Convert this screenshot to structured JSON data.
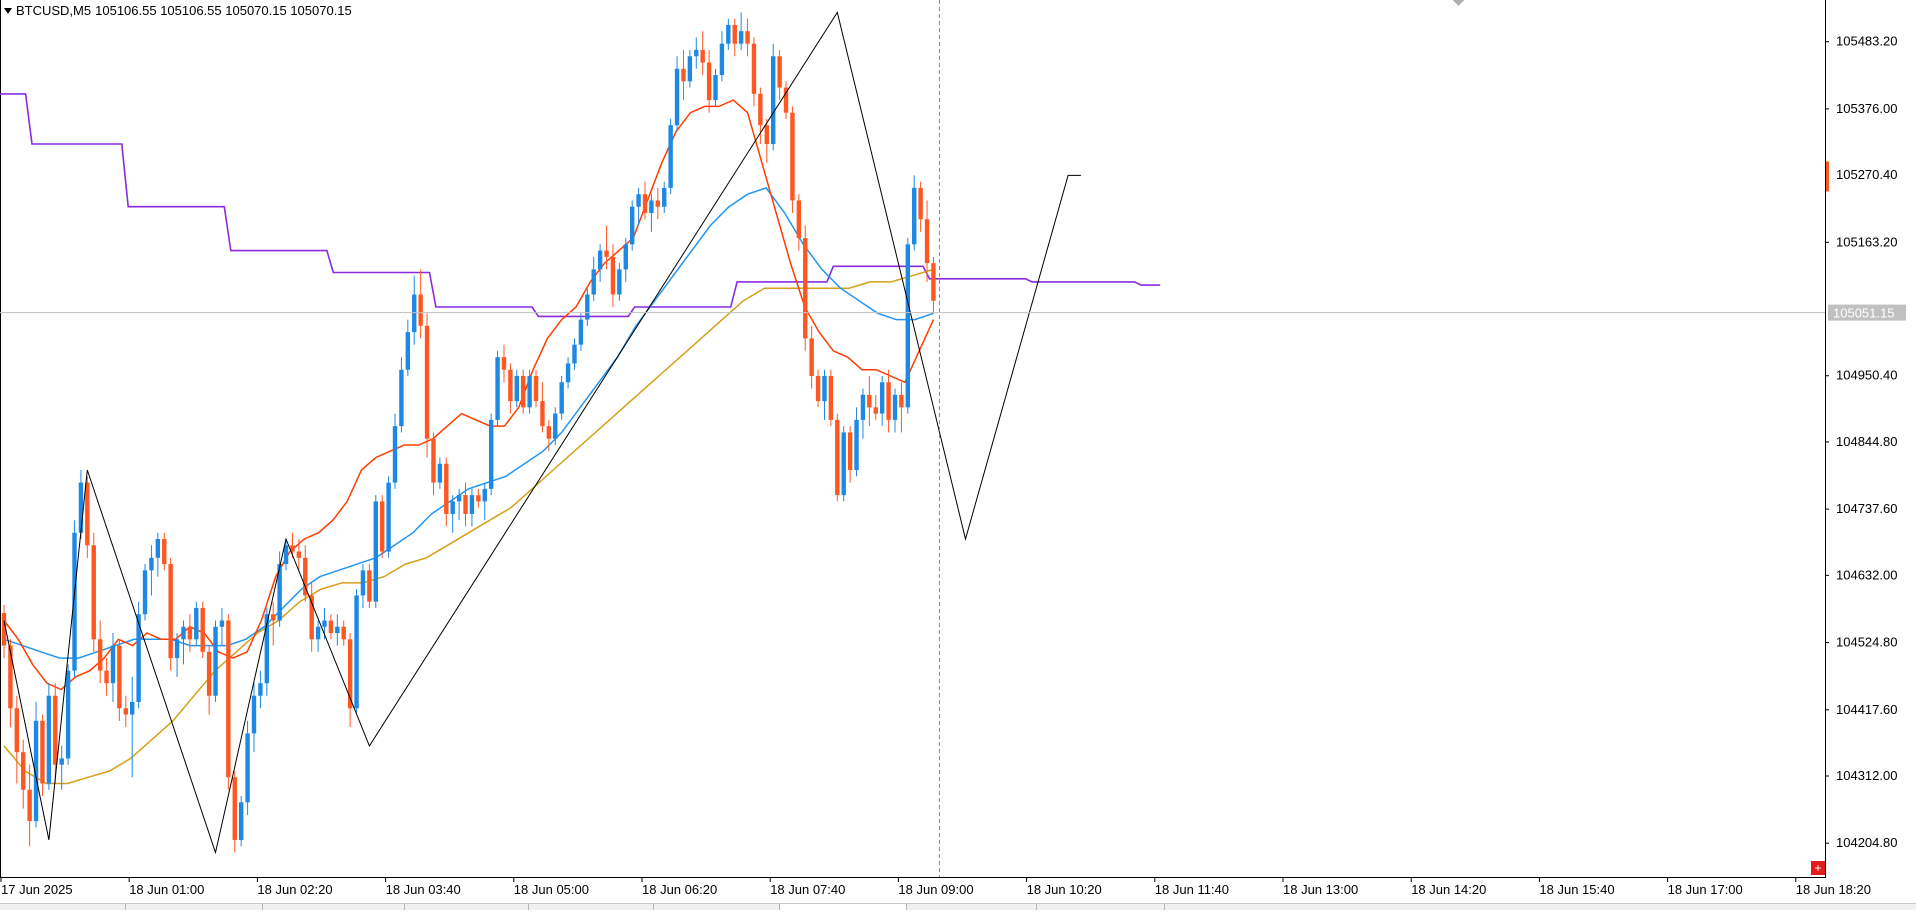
{
  "header": {
    "symbol_label": "BTCUSD,M5",
    "ohlc": "105106.55 105106.55 105070.15 105070.15",
    "dropdown_icon": "triangle-down-icon"
  },
  "price_axis": {
    "labels": [
      "105483.20",
      "105376.00",
      "105270.40",
      "105163.20",
      "104950.40",
      "104844.80",
      "104737.60",
      "104632.00",
      "104524.80",
      "104417.60",
      "104312.00",
      "104204.80"
    ],
    "current_price_tag": "105051.15",
    "ylim": [
      104170,
      105560
    ]
  },
  "time_axis": {
    "labels": [
      "17 Jun 2025",
      "18 Jun 01:00",
      "18 Jun 02:20",
      "18 Jun 03:40",
      "18 Jun 05:00",
      "18 Jun 06:20",
      "18 Jun 07:40",
      "18 Jun 09:00",
      "18 Jun 10:20",
      "18 Jun 11:40",
      "18 Jun 13:00",
      "18 Jun 14:20",
      "18 Jun 15:40",
      "18 Jun 17:00",
      "18 Jun 18:20"
    ]
  },
  "colors": {
    "bull": "#1e88e5",
    "bear": "#ff5722",
    "ma_fast": "#ff3d00",
    "ma_mid": "#2196f3",
    "ma_slow": "#d4a017",
    "step_line": "#8a2be2",
    "zigzag": "#000000",
    "price_tag_bg": "#c0c0c0",
    "last_candle_marker": "#ff5722"
  },
  "chart_data": {
    "type": "candlestick",
    "symbol": "BTCUSD",
    "timeframe": "M5",
    "candle_step_minutes": 5,
    "candles": [
      [
        104572,
        104585,
        104500,
        104520
      ],
      [
        104520,
        104530,
        104390,
        104420
      ],
      [
        104420,
        104440,
        104300,
        104350
      ],
      [
        104350,
        104370,
        104260,
        104290
      ],
      [
        104290,
        104330,
        104200,
        104240
      ],
      [
        104240,
        104430,
        104230,
        104400
      ],
      [
        104400,
        104410,
        104280,
        104300
      ],
      [
        104300,
        104460,
        104290,
        104440
      ],
      [
        104440,
        104460,
        104300,
        104330
      ],
      [
        104330,
        104360,
        104290,
        104340
      ],
      [
        104340,
        104490,
        104330,
        104480
      ],
      [
        104480,
        104720,
        104470,
        104700
      ],
      [
        104700,
        104800,
        104690,
        104780
      ],
      [
        104780,
        104790,
        104660,
        104680
      ],
      [
        104680,
        104700,
        104510,
        104530
      ],
      [
        104530,
        104560,
        104460,
        104480
      ],
      [
        104480,
        104500,
        104440,
        104460
      ],
      [
        104460,
        104540,
        104430,
        104520
      ],
      [
        104520,
        104530,
        104400,
        104420
      ],
      [
        104420,
        104440,
        104390,
        104410
      ],
      [
        104410,
        104470,
        104310,
        104430
      ],
      [
        104430,
        104590,
        104420,
        104570
      ],
      [
        104570,
        104650,
        104560,
        104640
      ],
      [
        104640,
        104680,
        104600,
        104660
      ],
      [
        104660,
        104700,
        104630,
        104690
      ],
      [
        104690,
        104700,
        104640,
        104650
      ],
      [
        104650,
        104660,
        104480,
        104500
      ],
      [
        104500,
        104540,
        104470,
        104530
      ],
      [
        104530,
        104560,
        104490,
        104550
      ],
      [
        104550,
        104570,
        104510,
        104530
      ],
      [
        104530,
        104590,
        104520,
        104580
      ],
      [
        104580,
        104590,
        104500,
        104510
      ],
      [
        104510,
        104520,
        104410,
        104440
      ],
      [
        104440,
        104560,
        104430,
        104550
      ],
      [
        104550,
        104580,
        104520,
        104560
      ],
      [
        104560,
        104570,
        104290,
        104310
      ],
      [
        104310,
        104320,
        104190,
        104210
      ],
      [
        104210,
        104280,
        104200,
        104270
      ],
      [
        104270,
        104400,
        104250,
        104380
      ],
      [
        104380,
        104460,
        104350,
        104440
      ],
      [
        104440,
        104480,
        104420,
        104460
      ],
      [
        104460,
        104580,
        104440,
        104570
      ],
      [
        104570,
        104590,
        104520,
        104560
      ],
      [
        104560,
        104670,
        104550,
        104650
      ],
      [
        104650,
        104690,
        104640,
        104680
      ],
      [
        104680,
        104700,
        104660,
        104670
      ],
      [
        104670,
        104690,
        104640,
        104660
      ],
      [
        104660,
        104680,
        104590,
        104600
      ],
      [
        104600,
        104620,
        104510,
        104530
      ],
      [
        104530,
        104560,
        104510,
        104550
      ],
      [
        104550,
        104580,
        104530,
        104560
      ],
      [
        104560,
        104570,
        104530,
        104540
      ],
      [
        104540,
        104570,
        104520,
        104550
      ],
      [
        104550,
        104560,
        104520,
        104530
      ],
      [
        104530,
        104540,
        104390,
        104420
      ],
      [
        104420,
        104610,
        104410,
        104600
      ],
      [
        104600,
        104650,
        104580,
        104640
      ],
      [
        104640,
        104650,
        104580,
        104590
      ],
      [
        104590,
        104760,
        104580,
        104750
      ],
      [
        104750,
        104760,
        104660,
        104670
      ],
      [
        104670,
        104790,
        104660,
        104780
      ],
      [
        104780,
        104890,
        104770,
        104870
      ],
      [
        104870,
        104980,
        104860,
        104960
      ],
      [
        104960,
        105040,
        104950,
        105020
      ],
      [
        105020,
        105110,
        105000,
        105080
      ],
      [
        105080,
        105120,
        105010,
        105030
      ],
      [
        105030,
        105050,
        104820,
        104850
      ],
      [
        104850,
        104860,
        104760,
        104780
      ],
      [
        104780,
        104820,
        104770,
        104810
      ],
      [
        104810,
        104820,
        104710,
        104730
      ],
      [
        104730,
        104760,
        104700,
        104750
      ],
      [
        104750,
        104770,
        104720,
        104760
      ],
      [
        104760,
        104780,
        104710,
        104730
      ],
      [
        104730,
        104770,
        104710,
        104760
      ],
      [
        104760,
        104770,
        104740,
        104750
      ],
      [
        104750,
        104780,
        104720,
        104770
      ],
      [
        104770,
        104890,
        104760,
        104880
      ],
      [
        104880,
        104990,
        104870,
        104980
      ],
      [
        104980,
        105000,
        104940,
        104960
      ],
      [
        104960,
        104970,
        104890,
        104910
      ],
      [
        104910,
        104960,
        104900,
        104950
      ],
      [
        104950,
        104960,
        104890,
        104900
      ],
      [
        104900,
        104960,
        104890,
        104950
      ],
      [
        104950,
        104960,
        104900,
        104910
      ],
      [
        104910,
        104940,
        104860,
        104870
      ],
      [
        104870,
        104880,
        104830,
        104850
      ],
      [
        104850,
        104900,
        104840,
        104890
      ],
      [
        104890,
        104950,
        104880,
        104940
      ],
      [
        104940,
        104980,
        104930,
        104970
      ],
      [
        104970,
        105010,
        104960,
        105000
      ],
      [
        105000,
        105050,
        104990,
        105040
      ],
      [
        105040,
        105090,
        105030,
        105080
      ],
      [
        105080,
        105140,
        105070,
        105120
      ],
      [
        105120,
        105160,
        105100,
        105150
      ],
      [
        105150,
        105190,
        105120,
        105140
      ],
      [
        105140,
        105160,
        105060,
        105080
      ],
      [
        105080,
        105130,
        105070,
        105120
      ],
      [
        105120,
        105170,
        105100,
        105160
      ],
      [
        105160,
        105230,
        105150,
        105220
      ],
      [
        105220,
        105250,
        105190,
        105240
      ],
      [
        105240,
        105260,
        105200,
        105210
      ],
      [
        105210,
        105240,
        105180,
        105230
      ],
      [
        105230,
        105250,
        105200,
        105220
      ],
      [
        105220,
        105260,
        105210,
        105250
      ],
      [
        105250,
        105360,
        105240,
        105350
      ],
      [
        105350,
        105460,
        105340,
        105440
      ],
      [
        105440,
        105470,
        105390,
        105420
      ],
      [
        105420,
        105470,
        105410,
        105460
      ],
      [
        105460,
        105490,
        105440,
        105470
      ],
      [
        105470,
        105500,
        105430,
        105450
      ],
      [
        105450,
        105470,
        105370,
        105390
      ],
      [
        105390,
        105440,
        105380,
        105430
      ],
      [
        105430,
        105500,
        105420,
        105480
      ],
      [
        105480,
        105520,
        105470,
        105510
      ],
      [
        105510,
        105520,
        105460,
        105480
      ],
      [
        105480,
        105530,
        105470,
        105500
      ],
      [
        105500,
        105520,
        105460,
        105480
      ],
      [
        105480,
        105490,
        105380,
        105400
      ],
      [
        105400,
        105410,
        105320,
        105350
      ],
      [
        105350,
        105360,
        105290,
        105320
      ],
      [
        105320,
        105480,
        105310,
        105460
      ],
      [
        105460,
        105470,
        105390,
        105410
      ],
      [
        105410,
        105420,
        105360,
        105370
      ],
      [
        105370,
        105380,
        105210,
        105230
      ],
      [
        105230,
        105240,
        105150,
        105170
      ],
      [
        105170,
        105190,
        104990,
        105010
      ],
      [
        105010,
        105030,
        104930,
        104950
      ],
      [
        104950,
        104960,
        104900,
        104910
      ],
      [
        104910,
        104960,
        104880,
        104950
      ],
      [
        104950,
        104960,
        104870,
        104880
      ],
      [
        104880,
        104890,
        104750,
        104760
      ],
      [
        104760,
        104870,
        104750,
        104860
      ],
      [
        104860,
        104870,
        104780,
        104800
      ],
      [
        104800,
        104900,
        104790,
        104880
      ],
      [
        104880,
        104930,
        104850,
        104920
      ],
      [
        104920,
        104950,
        104870,
        104900
      ],
      [
        104900,
        104920,
        104880,
        104890
      ],
      [
        104890,
        104950,
        104870,
        104940
      ],
      [
        104940,
        104960,
        104860,
        104880
      ],
      [
        104880,
        104930,
        104860,
        104920
      ],
      [
        104920,
        104940,
        104860,
        104900
      ],
      [
        104900,
        105170,
        104890,
        105160
      ],
      [
        105160,
        105270,
        105150,
        105250
      ],
      [
        105250,
        105260,
        105180,
        105200
      ],
      [
        105200,
        105230,
        105100,
        105130
      ],
      [
        105130,
        105140,
        105050,
        105070
      ]
    ],
    "ma_fast": [
      104560,
      104530,
      104490,
      104460,
      104450,
      104470,
      104480,
      104500,
      104530,
      104520,
      104540,
      104530,
      104530,
      104550,
      104540,
      104510,
      104500,
      104510,
      104560,
      104630,
      104670,
      104690,
      104700,
      104720,
      104750,
      104800,
      104820,
      104830,
      104840,
      104840,
      104850,
      104870,
      104890,
      104880,
      104870,
      104870,
      104900,
      104960,
      105010,
      105040,
      105060,
      105100,
      105130,
      105150,
      105170,
      105230,
      105290,
      105340,
      105370,
      105380,
      105380,
      105390,
      105370,
      105290,
      105210,
      105130,
      105060,
      105020,
      104990,
      104980,
      104960,
      104960,
      104950,
      104940,
      104990,
      105040
    ],
    "ma_mid": [
      104530,
      104520,
      104510,
      104500,
      104500,
      104510,
      104520,
      104530,
      104530,
      104530,
      104520,
      104520,
      104520,
      104530,
      104550,
      104580,
      104610,
      104630,
      104640,
      104650,
      104660,
      104680,
      104700,
      104730,
      104750,
      104770,
      104780,
      104790,
      104810,
      104830,
      104860,
      104900,
      104940,
      104980,
      105030,
      105070,
      105110,
      105150,
      105190,
      105220,
      105240,
      105250,
      105210,
      105160,
      105120,
      105090,
      105070,
      105050,
      105040,
      105040,
      105050
    ],
    "ma_slow": [
      104360,
      104320,
      104300,
      104300,
      104310,
      104320,
      104340,
      104370,
      104400,
      104440,
      104480,
      104510,
      104540,
      104560,
      104590,
      104610,
      104620,
      104620,
      104630,
      104650,
      104660,
      104680,
      104700,
      104720,
      104740,
      104770,
      104800,
      104830,
      104860,
      104890,
      104920,
      104950,
      104980,
      105010,
      105040,
      105070,
      105090,
      105090,
      105090,
      105090,
      105090,
      105100,
      105100,
      105110,
      105120
    ],
    "step_line": [
      [
        0,
        105400
      ],
      [
        4,
        105400
      ],
      [
        5,
        105320
      ],
      [
        19,
        105320
      ],
      [
        20,
        105220
      ],
      [
        35,
        105220
      ],
      [
        36,
        105150
      ],
      [
        51,
        105150
      ],
      [
        52,
        105115
      ],
      [
        67,
        105115
      ],
      [
        68,
        105060
      ],
      [
        83,
        105060
      ],
      [
        84,
        105045
      ],
      [
        98,
        105045
      ],
      [
        99,
        105060
      ],
      [
        114,
        105060
      ],
      [
        115,
        105100
      ],
      [
        129,
        105100
      ],
      [
        130,
        105125
      ],
      [
        144,
        105125
      ],
      [
        145,
        105105
      ],
      [
        160,
        105105
      ],
      [
        161,
        105100
      ],
      [
        177,
        105100
      ],
      [
        178,
        105095
      ],
      [
        181,
        105095
      ]
    ],
    "zigzag": [
      [
        0,
        104560
      ],
      [
        7,
        104210
      ],
      [
        13,
        104800
      ],
      [
        33,
        104190
      ],
      [
        44,
        104690
      ],
      [
        57,
        104360
      ],
      [
        130,
        105530
      ],
      [
        150,
        104690
      ],
      [
        166,
        105270
      ],
      [
        168,
        105270
      ]
    ],
    "current_price": 105051.15
  }
}
